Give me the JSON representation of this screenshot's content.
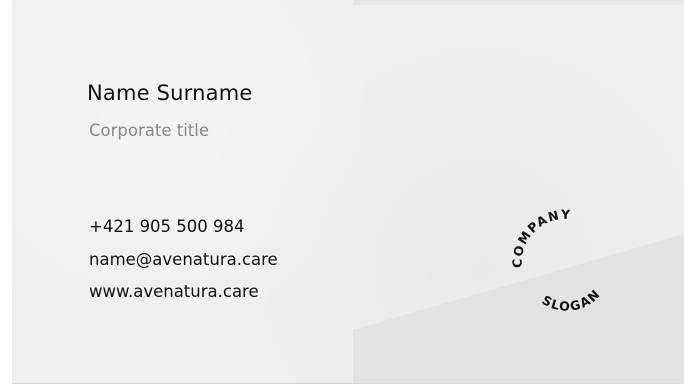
{
  "card": {
    "name": "Name Surname",
    "title": "Corporate title",
    "phone": "+421 905 500 984",
    "email": "name@avenatura.care",
    "website": "www.avenatura.care"
  },
  "logo": {
    "top_text": "COMPANY",
    "bottom_text": "SLOGAN"
  },
  "colors": {
    "card_background": "#efefee",
    "shade": "#e2e3e2",
    "text_primary": "#111111",
    "text_secondary": "#888888"
  }
}
